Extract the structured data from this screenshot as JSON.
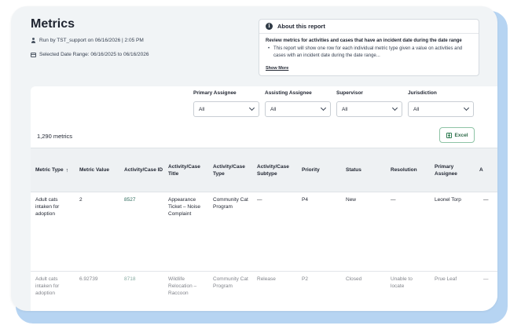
{
  "page": {
    "title": "Metrics"
  },
  "meta": {
    "run_by": "Run by TST_support on 06/16/2026 | 2:05 PM",
    "date_range": "Selected Date Range: 06/16/2025 to 06/16/2026"
  },
  "about": {
    "title": "About this report",
    "description": "Review metrics for activities and cases that have an incident date during the date range",
    "bullet": "This report will show one row for each individual metric type given a value on activities and cases with an incident date during the date range...",
    "show_more": "Show More"
  },
  "filters": [
    {
      "label": "Primary Assignee",
      "value": "All"
    },
    {
      "label": "Assisting Assignee",
      "value": "All"
    },
    {
      "label": "Supervisor",
      "value": "All"
    },
    {
      "label": "Jurisdiction",
      "value": "All"
    }
  ],
  "results": {
    "count": "1,290 metrics",
    "excel_label": "Excel"
  },
  "table": {
    "columns": [
      "Metric Type",
      "Metric Value",
      "Activity/Case ID",
      "Activity/Case Title",
      "Activity/Case Type",
      "Activity/Case Subtype",
      "Priority",
      "Status",
      "Resolution",
      "Primary Assignee",
      "A"
    ],
    "sort_indicator": "↑",
    "rows": [
      [
        "Adult cats intaken for adoption",
        "2",
        "8527",
        "Appearance Ticket – Noise Complaint",
        "Community Cat Program",
        "—",
        "P4",
        "New",
        "—",
        "Leonel Torp",
        "—"
      ],
      [
        "Adult cats intaken for adoption",
        "6.92739",
        "8718",
        "Wildlife Relocation – Raccoon",
        "Community Cat Program",
        "Release",
        "P2",
        "Closed",
        "Unable to locate",
        "Prue Leaf",
        "—"
      ]
    ]
  },
  "colors": {
    "accent": "#2e6b5c",
    "backdrop": "#b6d4f2",
    "excel_border": "#8fc4a6"
  },
  "icons": [
    "person-icon",
    "calendar-icon",
    "info-icon",
    "chevron-down-icon",
    "excel-icon",
    "sort-arrow-icon"
  ]
}
